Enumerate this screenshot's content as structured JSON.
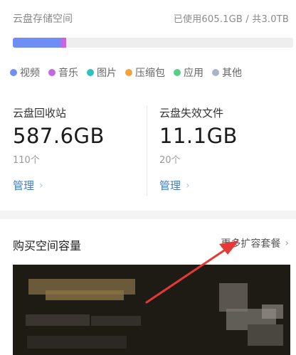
{
  "storage": {
    "title": "云盘存储空间",
    "usage_text": "已使用605.1GB / 共3.0TB",
    "bar": {
      "used_fraction_video": 0.17,
      "used_fraction_music": 0.02,
      "color_video": "#6f8ef5",
      "color_music": "#c766e3",
      "track_color": "#eeeeee"
    },
    "legend": [
      {
        "label": "视频",
        "color": "#6f8ef5"
      },
      {
        "label": "音乐",
        "color": "#c766e3"
      },
      {
        "label": "图片",
        "color": "#2fc1bf"
      },
      {
        "label": "压缩包",
        "color": "#f7a23a"
      },
      {
        "label": "应用",
        "color": "#57cf86"
      },
      {
        "label": "其他",
        "color": "#a9b5c7"
      }
    ]
  },
  "recycle": {
    "label": "云盘回收站",
    "value": "587.6GB",
    "count": "110个",
    "manage": "管理"
  },
  "invalid": {
    "label": "云盘失效文件",
    "value": "11.1GB",
    "count": "20个",
    "manage": "管理"
  },
  "purchase": {
    "title": "购买空间容量",
    "more_label": "更多扩容套餐"
  },
  "colors": {
    "link": "#3f7fbf",
    "annotation": "#e53935"
  }
}
